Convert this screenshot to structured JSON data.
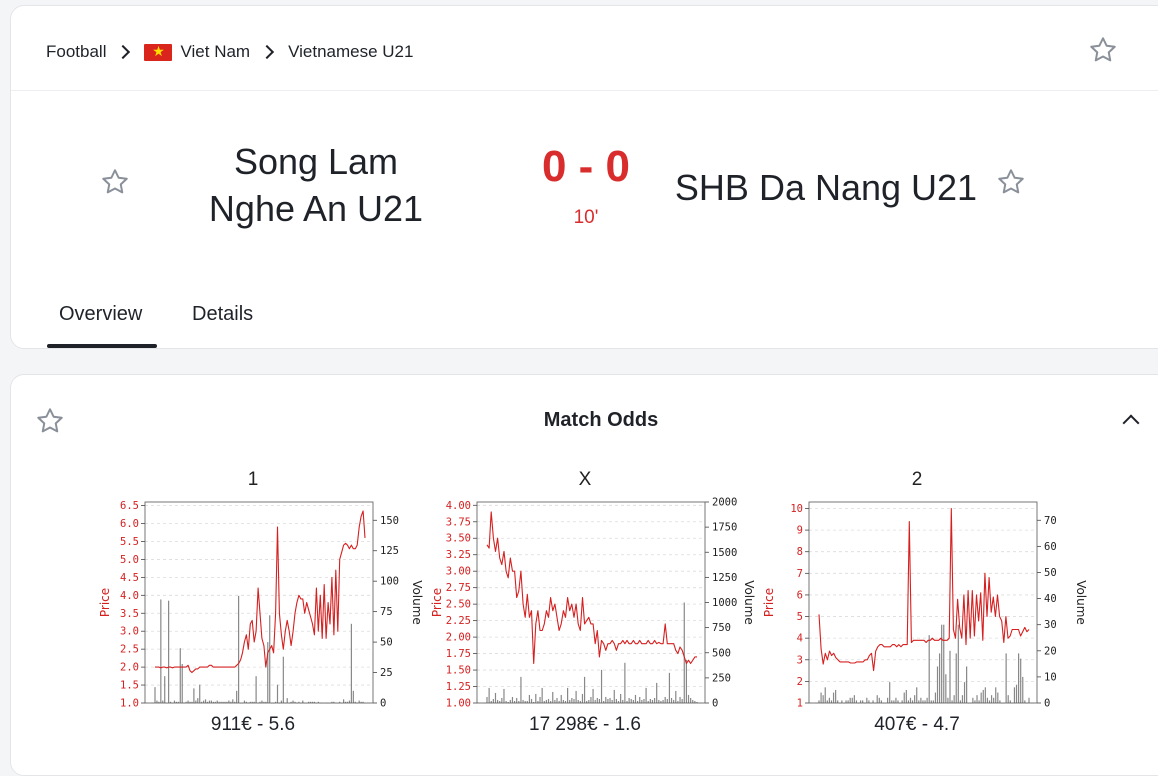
{
  "breadcrumb": {
    "sport": "Football",
    "country": "Viet Nam",
    "league": "Vietnamese U21"
  },
  "match": {
    "home": "Song Lam Nghe An U21",
    "away": "SHB Da Nang U21",
    "score": "0 - 0",
    "minute": "10'"
  },
  "tabs": [
    {
      "label": "Overview",
      "active": true
    },
    {
      "label": "Details",
      "active": false
    }
  ],
  "odds_section": {
    "title": "Match Odds"
  },
  "colors": {
    "score": "#d92c2c",
    "price_line": "#d62020",
    "volume_bar": "#888888"
  },
  "icons": {
    "favorite": "star-outline-icon",
    "collapse": "chevron-up-icon",
    "separator": "chevron-right-icon",
    "flag": "vietnam-flag-icon"
  },
  "chart_data": [
    {
      "type": "line",
      "title": "1",
      "caption": "911€ - 5.6",
      "ylabel": "Price",
      "y2label": "Volume",
      "ylim": [
        1.0,
        6.6
      ],
      "yticks": [
        "1.0",
        "1.5",
        "2.0",
        "2.5",
        "3.0",
        "3.5",
        "4.0",
        "4.5",
        "5.0",
        "5.5",
        "6.0",
        "6.5"
      ],
      "y2lim": [
        0,
        165
      ],
      "y2ticks": [
        "0",
        "25",
        "50",
        "75",
        "100",
        "125",
        "150"
      ],
      "price": [
        2.0,
        2.0,
        2.0,
        1.98,
        2.0,
        2.0,
        1.98,
        2.0,
        2.0,
        1.98,
        2.0,
        2.0,
        2.0,
        2.0,
        2.0,
        2.0,
        2.0,
        2.05,
        1.9,
        1.85,
        1.9,
        1.95,
        1.95,
        2.0,
        2.0,
        2.0,
        2.0,
        2.0,
        2.05,
        2.05,
        2.0,
        2.0,
        2.0,
        2.0,
        2.0,
        2.0,
        2.0,
        2.0,
        2.0,
        2.0,
        2.0,
        2.0,
        2.05,
        2.1,
        2.2,
        2.4,
        2.7,
        2.9,
        2.5,
        3.2,
        3.3,
        2.7,
        3.0,
        4.2,
        3.5,
        2.8,
        2.6,
        2.0,
        2.4,
        2.5,
        2.6,
        2.4,
        3.5,
        5.9,
        3.5,
        2.9,
        2.5,
        3.0,
        3.3,
        3.0,
        2.6,
        3.0,
        3.5,
        3.8,
        4.0,
        3.9,
        3.9,
        3.5,
        3.8,
        3.6,
        3.4,
        3.2,
        2.9,
        4.2,
        3.0,
        4.0,
        2.8,
        4.3,
        2.8,
        3.8,
        3.2,
        4.5,
        2.9,
        4.7,
        3.0,
        5.0,
        5.2,
        5.4,
        5.45,
        5.4,
        5.3,
        5.4,
        5.3,
        5.3,
        5.4,
        5.9,
        6.2,
        6.35,
        5.6
      ],
      "volume": [
        13,
        2,
        1,
        85,
        2,
        22,
        0,
        84,
        1,
        0,
        2,
        1,
        1,
        45,
        32,
        0,
        1,
        2,
        1,
        1,
        12,
        2,
        4,
        15,
        1,
        2,
        3,
        1,
        2,
        2,
        1,
        1,
        2,
        1,
        1,
        1,
        1,
        1,
        2,
        1,
        3,
        1,
        10,
        88,
        0,
        0,
        2,
        1,
        0,
        1,
        1,
        1,
        22,
        0,
        1,
        2,
        1,
        1,
        50,
        72,
        0,
        0,
        1,
        15,
        0,
        2,
        38,
        0,
        4,
        0,
        1,
        2,
        1,
        0,
        1,
        0,
        2,
        0,
        0,
        1,
        1,
        1,
        1,
        0,
        1,
        0,
        0,
        0,
        0,
        0,
        0,
        1,
        1,
        0,
        0,
        1,
        0,
        3,
        1,
        1,
        2,
        65,
        10,
        1,
        0,
        2,
        1,
        1,
        0
      ]
    },
    {
      "type": "line",
      "title": "X",
      "caption": "17 298€ - 1.6",
      "ylabel": "Price",
      "y2label": "Volume",
      "ylim": [
        1.0,
        4.05
      ],
      "yticks": [
        "1.00",
        "1.25",
        "1.50",
        "1.75",
        "2.00",
        "2.25",
        "2.50",
        "2.75",
        "3.00",
        "3.25",
        "3.50",
        "3.75",
        "4.00"
      ],
      "y2lim": [
        0,
        2000
      ],
      "y2ticks": [
        "0",
        "250",
        "500",
        "750",
        "1000",
        "1250",
        "1500",
        "1750",
        "2000"
      ],
      "price": [
        3.4,
        3.35,
        3.9,
        3.5,
        3.3,
        3.5,
        3.2,
        3.1,
        3.3,
        3.0,
        2.9,
        3.2,
        3.0,
        3.0,
        2.6,
        2.7,
        3.0,
        2.5,
        2.3,
        2.65,
        2.3,
        2.4,
        1.6,
        2.2,
        2.4,
        2.1,
        2.1,
        2.2,
        2.4,
        2.3,
        2.6,
        2.4,
        2.5,
        2.3,
        2.1,
        2.2,
        2.4,
        2.3,
        2.6,
        2.4,
        2.5,
        2.3,
        2.5,
        2.2,
        2.1,
        2.6,
        2.2,
        2.25,
        2.3,
        2.2,
        2.2,
        1.9,
        2.1,
        1.7,
        1.95,
        1.9,
        1.8,
        1.9,
        1.9,
        1.95,
        1.9,
        1.8,
        1.9,
        1.9,
        1.95,
        1.9,
        1.95,
        1.9,
        1.9,
        1.95,
        1.9,
        1.9,
        1.95,
        1.9,
        1.9,
        1.9,
        1.95,
        1.9,
        1.9,
        1.95,
        1.9,
        1.92,
        1.9,
        1.9,
        2.2,
        1.9,
        1.9,
        1.9,
        1.9,
        1.8,
        1.75,
        1.85,
        1.8,
        1.7,
        1.6,
        1.65,
        1.6,
        1.65,
        1.7,
        1.7
      ],
      "volume": [
        60,
        150,
        20,
        40,
        100,
        30,
        20,
        50,
        140,
        20,
        10,
        30,
        60,
        20,
        50,
        20,
        260,
        30,
        20,
        20,
        80,
        40,
        10,
        90,
        20,
        60,
        150,
        20,
        30,
        40,
        20,
        110,
        30,
        50,
        20,
        80,
        30,
        20,
        150,
        30,
        50,
        40,
        120,
        30,
        20,
        90,
        260,
        20,
        30,
        60,
        140,
        30,
        50,
        40,
        330,
        20,
        60,
        40,
        50,
        30,
        130,
        40,
        20,
        90,
        30,
        400,
        20,
        50,
        40,
        30,
        80,
        20,
        60,
        30,
        40,
        150,
        20,
        40,
        30,
        50,
        200,
        30,
        20,
        30,
        60,
        40,
        300,
        50,
        30,
        120,
        20,
        60,
        40,
        1000,
        430,
        80,
        50,
        30,
        20,
        10
      ]
    },
    {
      "type": "line",
      "title": "2",
      "caption": "407€ - 4.7",
      "ylabel": "Price",
      "y2label": "Volume",
      "ylim": [
        1,
        10.3
      ],
      "yticks": [
        "1",
        "2",
        "3",
        "4",
        "5",
        "6",
        "7",
        "8",
        "9",
        "10"
      ],
      "y2lim": [
        0,
        77
      ],
      "y2ticks": [
        "0",
        "10",
        "20",
        "30",
        "40",
        "50",
        "60",
        "70"
      ],
      "price": [
        5.1,
        3.5,
        2.8,
        3.3,
        3.0,
        3.4,
        3.2,
        3.3,
        3.1,
        3.0,
        2.9,
        2.9,
        2.9,
        2.9,
        2.9,
        2.85,
        2.85,
        2.85,
        2.9,
        2.9,
        2.9,
        2.9,
        3.0,
        3.0,
        3.2,
        3.3,
        2.5,
        3.4,
        3.6,
        3.7,
        3.7,
        3.6,
        3.6,
        3.6,
        3.6,
        3.7,
        3.7,
        3.6,
        3.7,
        3.6,
        3.7,
        3.7,
        3.7,
        9.4,
        3.8,
        3.9,
        3.9,
        3.9,
        3.9,
        3.9,
        3.9,
        3.8,
        3.9,
        3.9,
        4.0,
        3.9,
        3.9,
        3.9,
        4.0,
        3.9,
        3.9,
        3.9,
        4.0,
        10.0,
        4.4,
        4.0,
        5.8,
        4.5,
        4.0,
        6.0,
        3.7,
        6.2,
        4.0,
        6.2,
        4.1,
        6.0,
        4.8,
        6.1,
        3.9,
        7.0,
        5.0,
        6.8,
        5.2,
        5.9,
        5.0,
        6.0,
        5.0,
        4.8,
        3.8,
        5.0,
        4.0,
        4.1,
        4.4,
        4.4,
        4.4,
        4.4,
        4.1,
        4.3,
        4.5,
        4.3,
        4.4
      ],
      "volume": [
        1,
        4,
        3,
        6,
        1,
        2,
        1,
        4,
        5,
        1,
        0,
        1,
        0,
        1,
        1,
        2,
        2,
        3,
        1,
        0,
        1,
        1,
        0,
        2,
        1,
        0,
        1,
        0,
        3,
        2,
        1,
        0,
        0,
        2,
        8,
        1,
        1,
        2,
        1,
        0,
        1,
        4,
        5,
        1,
        2,
        1,
        3,
        6,
        1,
        2,
        1,
        1,
        2,
        26,
        1,
        1,
        4,
        14,
        19,
        30,
        30,
        11,
        2,
        20,
        1,
        3,
        19,
        30,
        1,
        3,
        8,
        14,
        0,
        0,
        2,
        1,
        3,
        1,
        4,
        5,
        6,
        2,
        1,
        3,
        2,
        6,
        4,
        1,
        0,
        0,
        19,
        3,
        1,
        0,
        6,
        7,
        19,
        17,
        10,
        1,
        0,
        2
      ]
    }
  ]
}
